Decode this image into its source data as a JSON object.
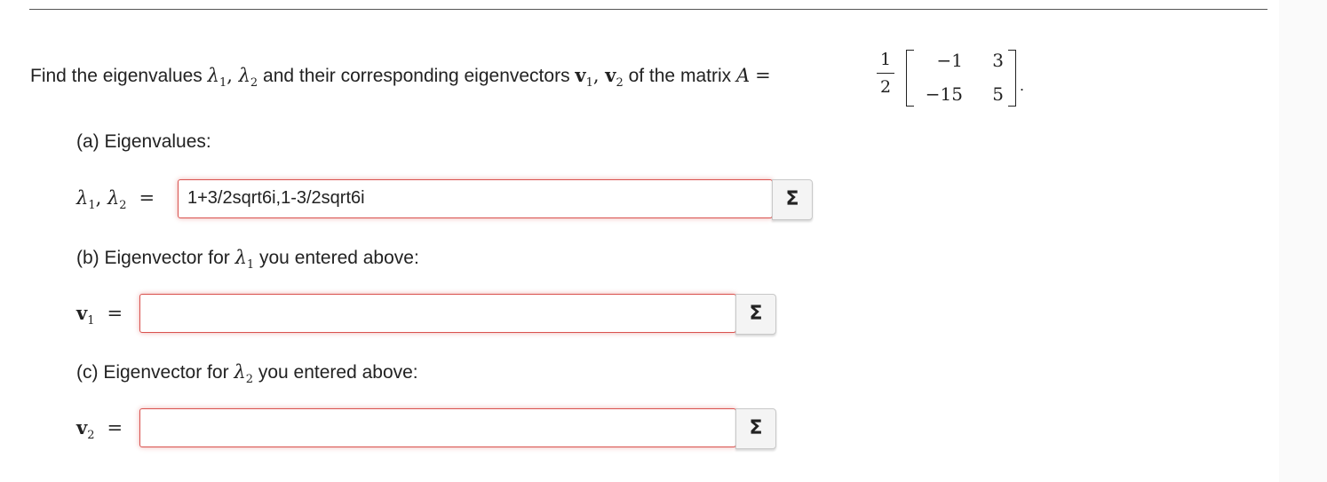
{
  "question": {
    "prefix": "Find the eigenvalues ",
    "lambda1": "λ",
    "sub1": "1",
    "sep1": ", ",
    "lambda2": "λ",
    "sub2": "2",
    "middle": " and their corresponding eigenvectors ",
    "v1": "v",
    "vsub1": "1",
    "sep2": ", ",
    "v2": "v",
    "vsub2": "2",
    "suffix": " of the matrix ",
    "matrix_name": "A",
    "equals": "="
  },
  "fraction": {
    "numerator": "1",
    "denominator": "2"
  },
  "matrix": {
    "a11": "−1",
    "a12": "3",
    "a21": "−15",
    "a22": "5"
  },
  "period": ".",
  "part_a": {
    "label": "(a) Eigenvalues:",
    "lhs_lambda": "λ",
    "lhs_sub1": "1",
    "lhs_sep": ", ",
    "lhs_lambda2": "λ",
    "lhs_sub2": "2",
    "equals": "=",
    "value": "1+3/2sqrt6i,1-3/2sqrt6i",
    "sigma": "Σ"
  },
  "part_b": {
    "label_prefix": "(b) Eigenvector for ",
    "label_lambda": "λ",
    "label_sub": "1",
    "label_suffix": " you entered above:",
    "lhs_v": "v",
    "lhs_sub": "1",
    "equals": "=",
    "value": "",
    "sigma": "Σ"
  },
  "part_c": {
    "label_prefix": "(c) Eigenvector for ",
    "label_lambda": "λ",
    "label_sub": "2",
    "label_suffix": " you entered above:",
    "lhs_v": "v",
    "lhs_sub": "2",
    "equals": "=",
    "value": "",
    "sigma": "Σ"
  }
}
